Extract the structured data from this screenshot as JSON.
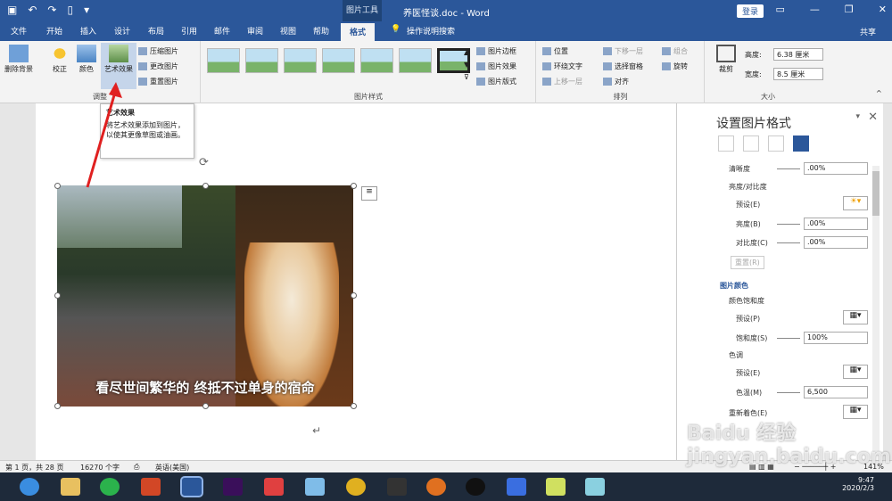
{
  "titlebar": {
    "context_group": "图片工具",
    "doc_title": "养医怪谈.doc - Word",
    "login": "登录"
  },
  "tabs": [
    {
      "label": "文件"
    },
    {
      "label": "开始"
    },
    {
      "label": "插入"
    },
    {
      "label": "设计"
    },
    {
      "label": "布局"
    },
    {
      "label": "引用"
    },
    {
      "label": "邮件"
    },
    {
      "label": "审阅"
    },
    {
      "label": "视图"
    },
    {
      "label": "帮助"
    },
    {
      "label": "格式",
      "active": true
    },
    {
      "label": "操作说明搜索"
    }
  ],
  "share": "共享",
  "ribbon": {
    "adjust": {
      "remove_bg": "删除背景",
      "correct": "校正",
      "color": "颜色",
      "art": "艺术效果",
      "compress": "压缩图片",
      "change": "更改图片",
      "reset": "重置图片",
      "label": "调整"
    },
    "styles": {
      "label": "图片样式",
      "border": "图片边框",
      "effects": "图片效果",
      "layout": "图片版式"
    },
    "arrange": {
      "position": "位置",
      "wrap": "环绕文字",
      "forward": "上移一层",
      "back": "下移一层",
      "pane": "选择窗格",
      "align": "对齐",
      "group": "组合",
      "rotate": "旋转",
      "label": "排列"
    },
    "size": {
      "crop": "裁剪",
      "height_label": "高度:",
      "height": "6.38 厘米",
      "width_label": "宽度:",
      "width": "8.5 厘米",
      "label": "大小"
    }
  },
  "tooltip": {
    "title": "艺术效果",
    "body": "将艺术效果添加到图片，以使其更像草图或油画。"
  },
  "picture": {
    "caption": "看尽世间繁华的 终抵不过单身的宿命"
  },
  "panel": {
    "title": "设置图片格式",
    "sharpness_label": "清晰度",
    "sharpness": ".00%",
    "bc_label": "亮度/对比度",
    "preset_label": "预设(E)",
    "brightness_label": "亮度(B)",
    "brightness": ".00%",
    "contrast_label": "对比度(C)",
    "contrast": ".00%",
    "reset": "重置(R)",
    "color_section": "图片颜色",
    "saturation_section": "颜色饱和度",
    "sat_preset_label": "预设(P)",
    "saturation_label": "饱和度(S)",
    "saturation": "100%",
    "tone_section": "色调",
    "tone_preset_label": "预设(E)",
    "temp_label": "色温(M)",
    "temp": "6,500",
    "recolor_label": "重新着色(E)"
  },
  "status": {
    "page": "第 1 页，共 28 页",
    "words": "16270 个字",
    "lang": "英语(美国)",
    "zoom": "141%"
  },
  "tray": {
    "time": "9:47",
    "date": "2020/2/3"
  },
  "watermark": "Baidu 经验 jingyan.baidu.com",
  "colors": {
    "accent": "#2b579a",
    "arrow": "#e02020"
  }
}
